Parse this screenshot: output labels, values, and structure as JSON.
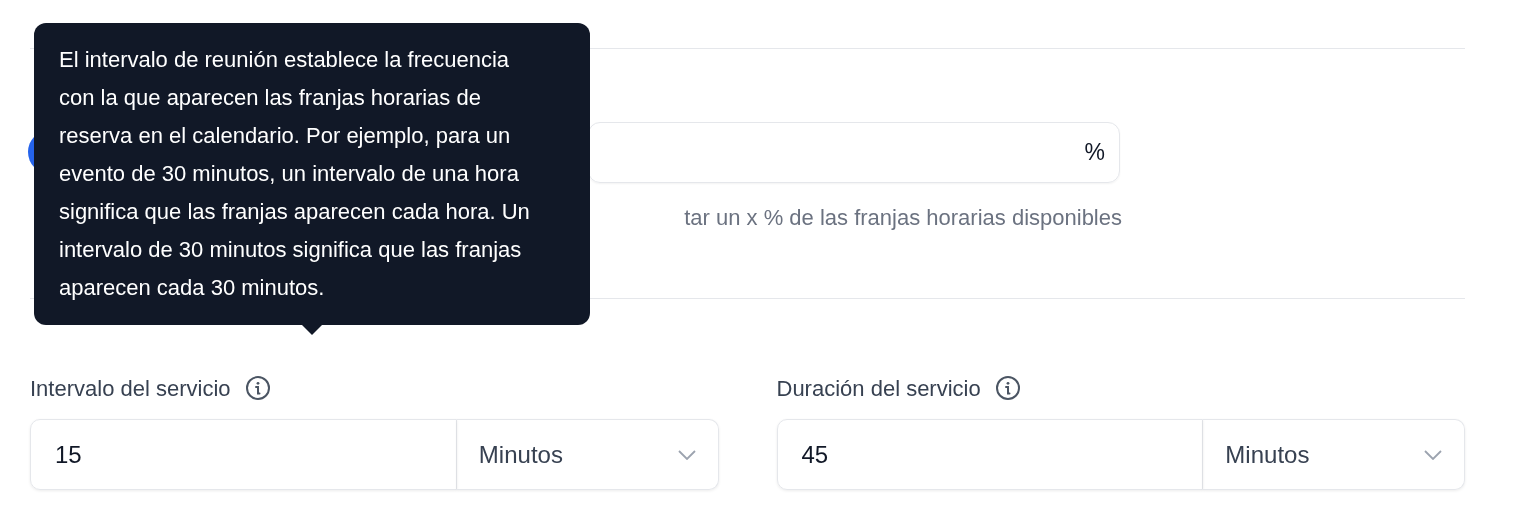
{
  "toggle": {
    "on": true
  },
  "percent_field": {
    "suffix": "%"
  },
  "helper_text": "tar un x % de las franjas horarias disponibles",
  "fields": [
    {
      "label": "Intervalo del servicio",
      "value": "15",
      "unit": "Minutos"
    },
    {
      "label": "Duración del servicio",
      "value": "45",
      "unit": "Minutos"
    }
  ],
  "tooltip": {
    "text": "El intervalo de reunión establece la frecuencia con la que aparecen las franjas horarias de reserva en el calendario. Por ejemplo, para un evento de 30 minutos, un intervalo de una hora significa que las franjas aparecen cada hora. Un intervalo de 30 minutos significa que las franjas aparecen cada 30 minutos."
  }
}
